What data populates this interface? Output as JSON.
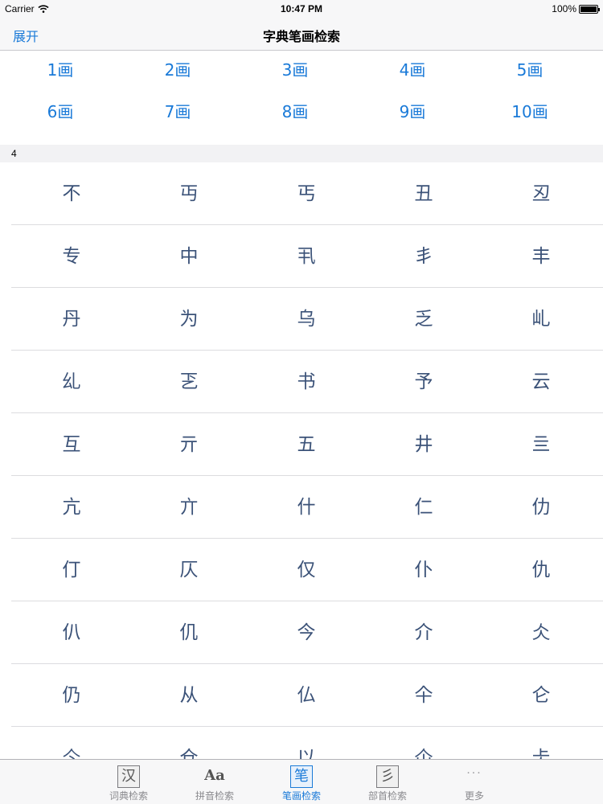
{
  "status_bar": {
    "carrier": "Carrier",
    "time": "10:47 PM",
    "battery": "100%"
  },
  "nav": {
    "left_button": "展开",
    "title": "字典笔画检索"
  },
  "stroke_counts": [
    "1画",
    "2画",
    "3画",
    "4画",
    "5画",
    "6画",
    "7画",
    "8画",
    "9画",
    "10画"
  ],
  "section": {
    "header": "4"
  },
  "characters": [
    [
      "不",
      "丏",
      "丐",
      "丑",
      "丒"
    ],
    [
      "专",
      "中",
      "丮",
      "丯",
      "丰"
    ],
    [
      "丹",
      "为",
      "乌",
      "乏",
      "乢"
    ],
    [
      "乣",
      "乤",
      "书",
      "予",
      "云"
    ],
    [
      "互",
      "亓",
      "五",
      "井",
      "亖"
    ],
    [
      "亢",
      "亣",
      "什",
      "仁",
      "仂"
    ],
    [
      "仃",
      "仄",
      "仅",
      "仆",
      "仇"
    ],
    [
      "仈",
      "仉",
      "今",
      "介",
      "仌"
    ],
    [
      "仍",
      "从",
      "仏",
      "仐",
      "仑"
    ],
    [
      "仒",
      "仓",
      "以",
      "仚",
      "仧"
    ]
  ],
  "tabs": [
    {
      "icon": "汉",
      "label": "词典检索",
      "active": false
    },
    {
      "icon": "Aa",
      "label": "拼音检索",
      "active": false
    },
    {
      "icon": "笔",
      "label": "笔画检索",
      "active": true
    },
    {
      "icon": "彡",
      "label": "部首检索",
      "active": false
    },
    {
      "icon": "···",
      "label": "更多",
      "active": false
    }
  ],
  "colors": {
    "accent": "#1a7ad8",
    "character": "#3b5278"
  }
}
